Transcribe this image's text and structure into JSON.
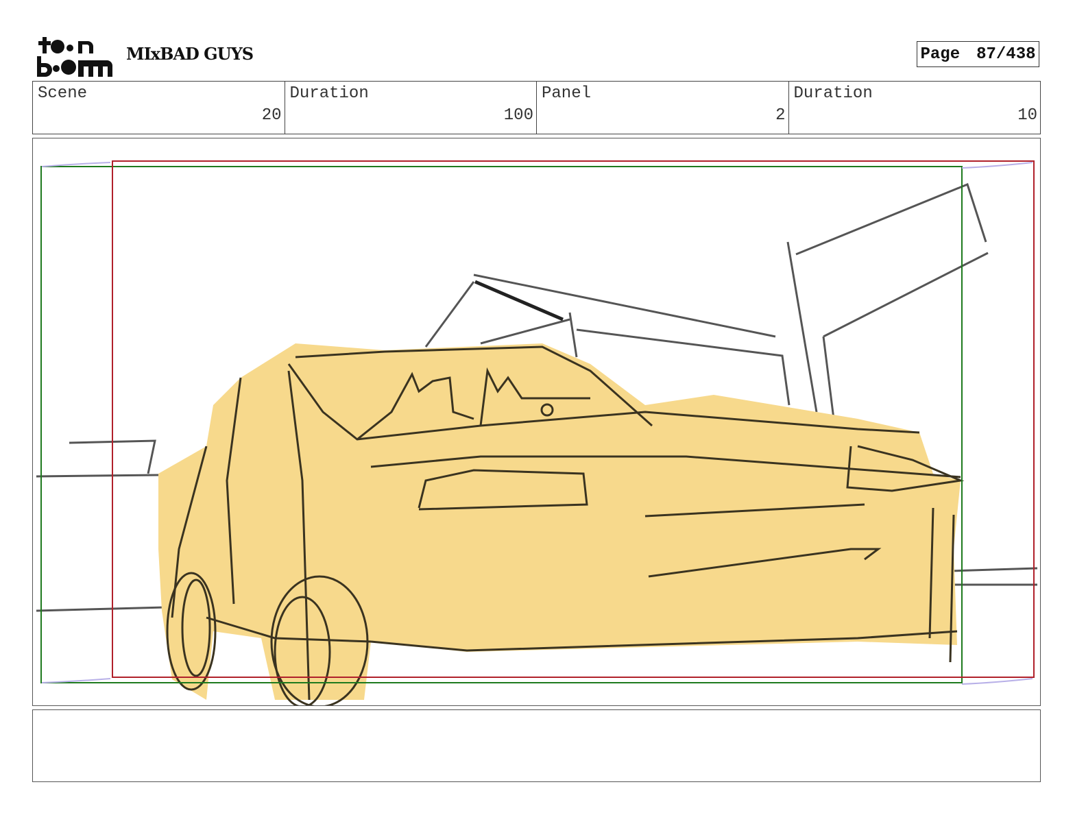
{
  "header": {
    "logo_text": "toon boom",
    "project_title": "MIxBAD GUYS",
    "page_label": "Page",
    "page_value": "87/438"
  },
  "info": [
    {
      "label": "Scene",
      "value": "20"
    },
    {
      "label": "Duration",
      "value": "100"
    },
    {
      "label": "Panel",
      "value": "2"
    },
    {
      "label": "Duration",
      "value": "10"
    }
  ],
  "colors": {
    "safe_frame": "#1e7a1e",
    "camera_frame": "#b0202a",
    "car_fill": "#f7d98c",
    "sketch_line": "#3a3320"
  },
  "notes": ""
}
